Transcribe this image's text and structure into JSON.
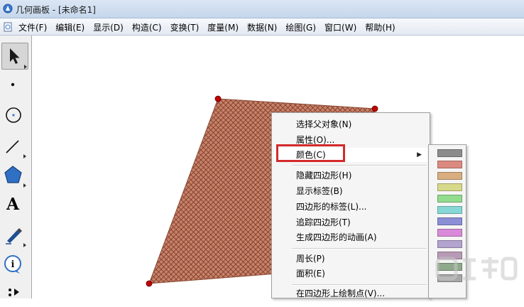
{
  "window": {
    "title": "几何画板 - [未命名1]"
  },
  "menubar": {
    "items": [
      "文件(F)",
      "编辑(E)",
      "显示(D)",
      "构造(C)",
      "变换(T)",
      "度量(M)",
      "数据(N)",
      "绘图(G)",
      "窗口(W)",
      "帮助(H)"
    ]
  },
  "toolbox": {
    "tools": [
      {
        "name": "select-arrow-tool",
        "icon": "arrow-cursor-icon",
        "selected": true
      },
      {
        "name": "point-tool",
        "icon": "point-icon"
      },
      {
        "name": "compass-tool",
        "icon": "circle-icon"
      },
      {
        "name": "straightedge-tool",
        "icon": "line-segment-icon"
      },
      {
        "name": "polygon-tool",
        "icon": "pentagon-icon"
      },
      {
        "name": "text-tool",
        "icon": "letter-a-icon",
        "label": "A"
      },
      {
        "name": "marker-tool",
        "icon": "marker-pen-icon"
      },
      {
        "name": "information-tool",
        "icon": "info-icon"
      },
      {
        "name": "custom-tool",
        "icon": "custom-tool-icon"
      }
    ]
  },
  "canvas": {
    "shape": "quadrilateral",
    "fill_color": "#c9826a",
    "hatch_color": "#7a3a26",
    "vertex_color": "#c00000"
  },
  "context_menu": {
    "items": [
      {
        "label": "选择父对象(N)"
      },
      {
        "label": "属性(O)..."
      },
      {
        "label": "颜色(C)",
        "submenu": true,
        "active": true
      },
      {
        "separator": true
      },
      {
        "label": "隐藏四边形(H)"
      },
      {
        "label": "显示标签(B)"
      },
      {
        "label": "四边形的标签(L)..."
      },
      {
        "label": "追踪四边形(T)"
      },
      {
        "label": "生成四边形的动画(A)"
      },
      {
        "separator": true
      },
      {
        "label": "周长(P)"
      },
      {
        "label": "面积(E)"
      },
      {
        "separator": true
      },
      {
        "label": "在四边形上绘制点(V)..."
      }
    ]
  },
  "color_submenu": {
    "swatches": [
      "#8c8c8c",
      "#dc8a80",
      "#d8ad80",
      "#d7d98a",
      "#92dc8e",
      "#86d8d6",
      "#8a8fd6",
      "#d98ad8",
      "#b3a3cf",
      "#b79ab5",
      "#8fa98a",
      "#a7a7a7"
    ]
  },
  "highlight": {
    "color": "#d42a2a"
  }
}
